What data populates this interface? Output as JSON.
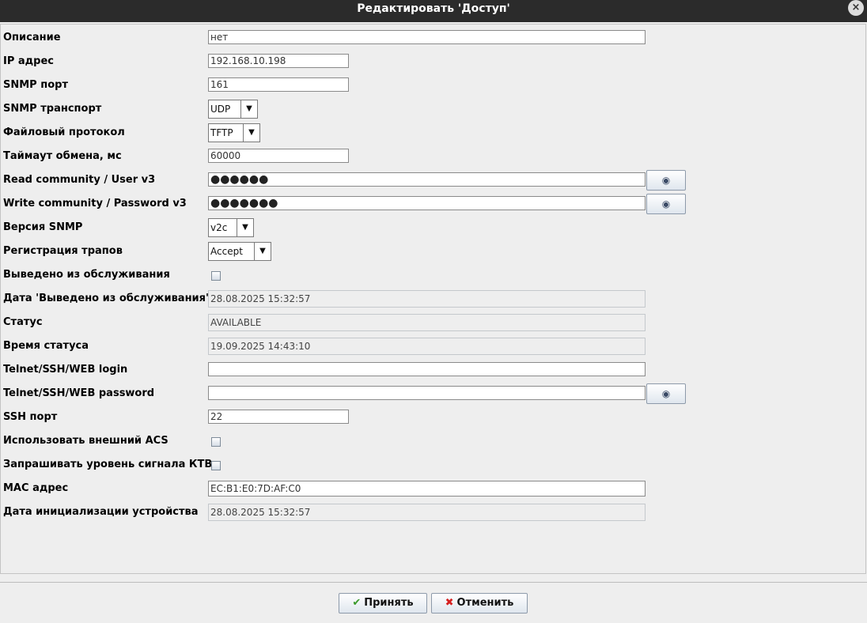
{
  "window": {
    "title": "Редактировать 'Доступ'",
    "close_icon": "×"
  },
  "icons": {
    "eye": "◉",
    "dropdown": "▼",
    "accept": "✔",
    "cancel": "✖"
  },
  "form": {
    "description": {
      "label": "Описание",
      "value": "нет"
    },
    "ip": {
      "label": "IP адрес",
      "value": "192.168.10.198"
    },
    "snmp_port": {
      "label": "SNMP порт",
      "value": "161"
    },
    "snmp_transport": {
      "label": "SNMP транспорт",
      "value": "UDP"
    },
    "file_protocol": {
      "label": "Файловый протокол",
      "value": "TFTP"
    },
    "timeout": {
      "label": "Таймаут обмена, мс",
      "value": "60000"
    },
    "read_community": {
      "label": "Read community / User v3",
      "value": "●●●●●●"
    },
    "write_community": {
      "label": "Write community / Password v3",
      "value": "●●●●●●●"
    },
    "snmp_version": {
      "label": "Версия SNMP",
      "value": "v2c"
    },
    "trap_registration": {
      "label": "Регистрация трапов",
      "value": "Accept"
    },
    "out_of_service": {
      "label": "Выведено из обслуживания",
      "checked": false
    },
    "out_of_service_date": {
      "label": "Дата 'Выведено из обслуживания'",
      "value": "28.08.2025 15:32:57"
    },
    "status": {
      "label": "Статус",
      "value": "AVAILABLE"
    },
    "status_time": {
      "label": "Время статуса",
      "value": "19.09.2025 14:43:10"
    },
    "login": {
      "label": "Telnet/SSH/WEB login",
      "value": ""
    },
    "password": {
      "label": "Telnet/SSH/WEB password",
      "value": ""
    },
    "ssh_port": {
      "label": "SSH порт",
      "value": "22"
    },
    "external_acs": {
      "label": "Использовать внешний ACS",
      "checked": false
    },
    "ktv_signal": {
      "label": "Запрашивать уровень сигнала КТВ",
      "checked": false
    },
    "mac": {
      "label": "MAC адрес",
      "value": "EC:B1:E0:7D:AF:C0"
    },
    "init_date": {
      "label": "Дата инициализации устройства",
      "value": "28.08.2025 15:32:57"
    }
  },
  "buttons": {
    "accept": "Принять",
    "cancel": "Отменить"
  }
}
